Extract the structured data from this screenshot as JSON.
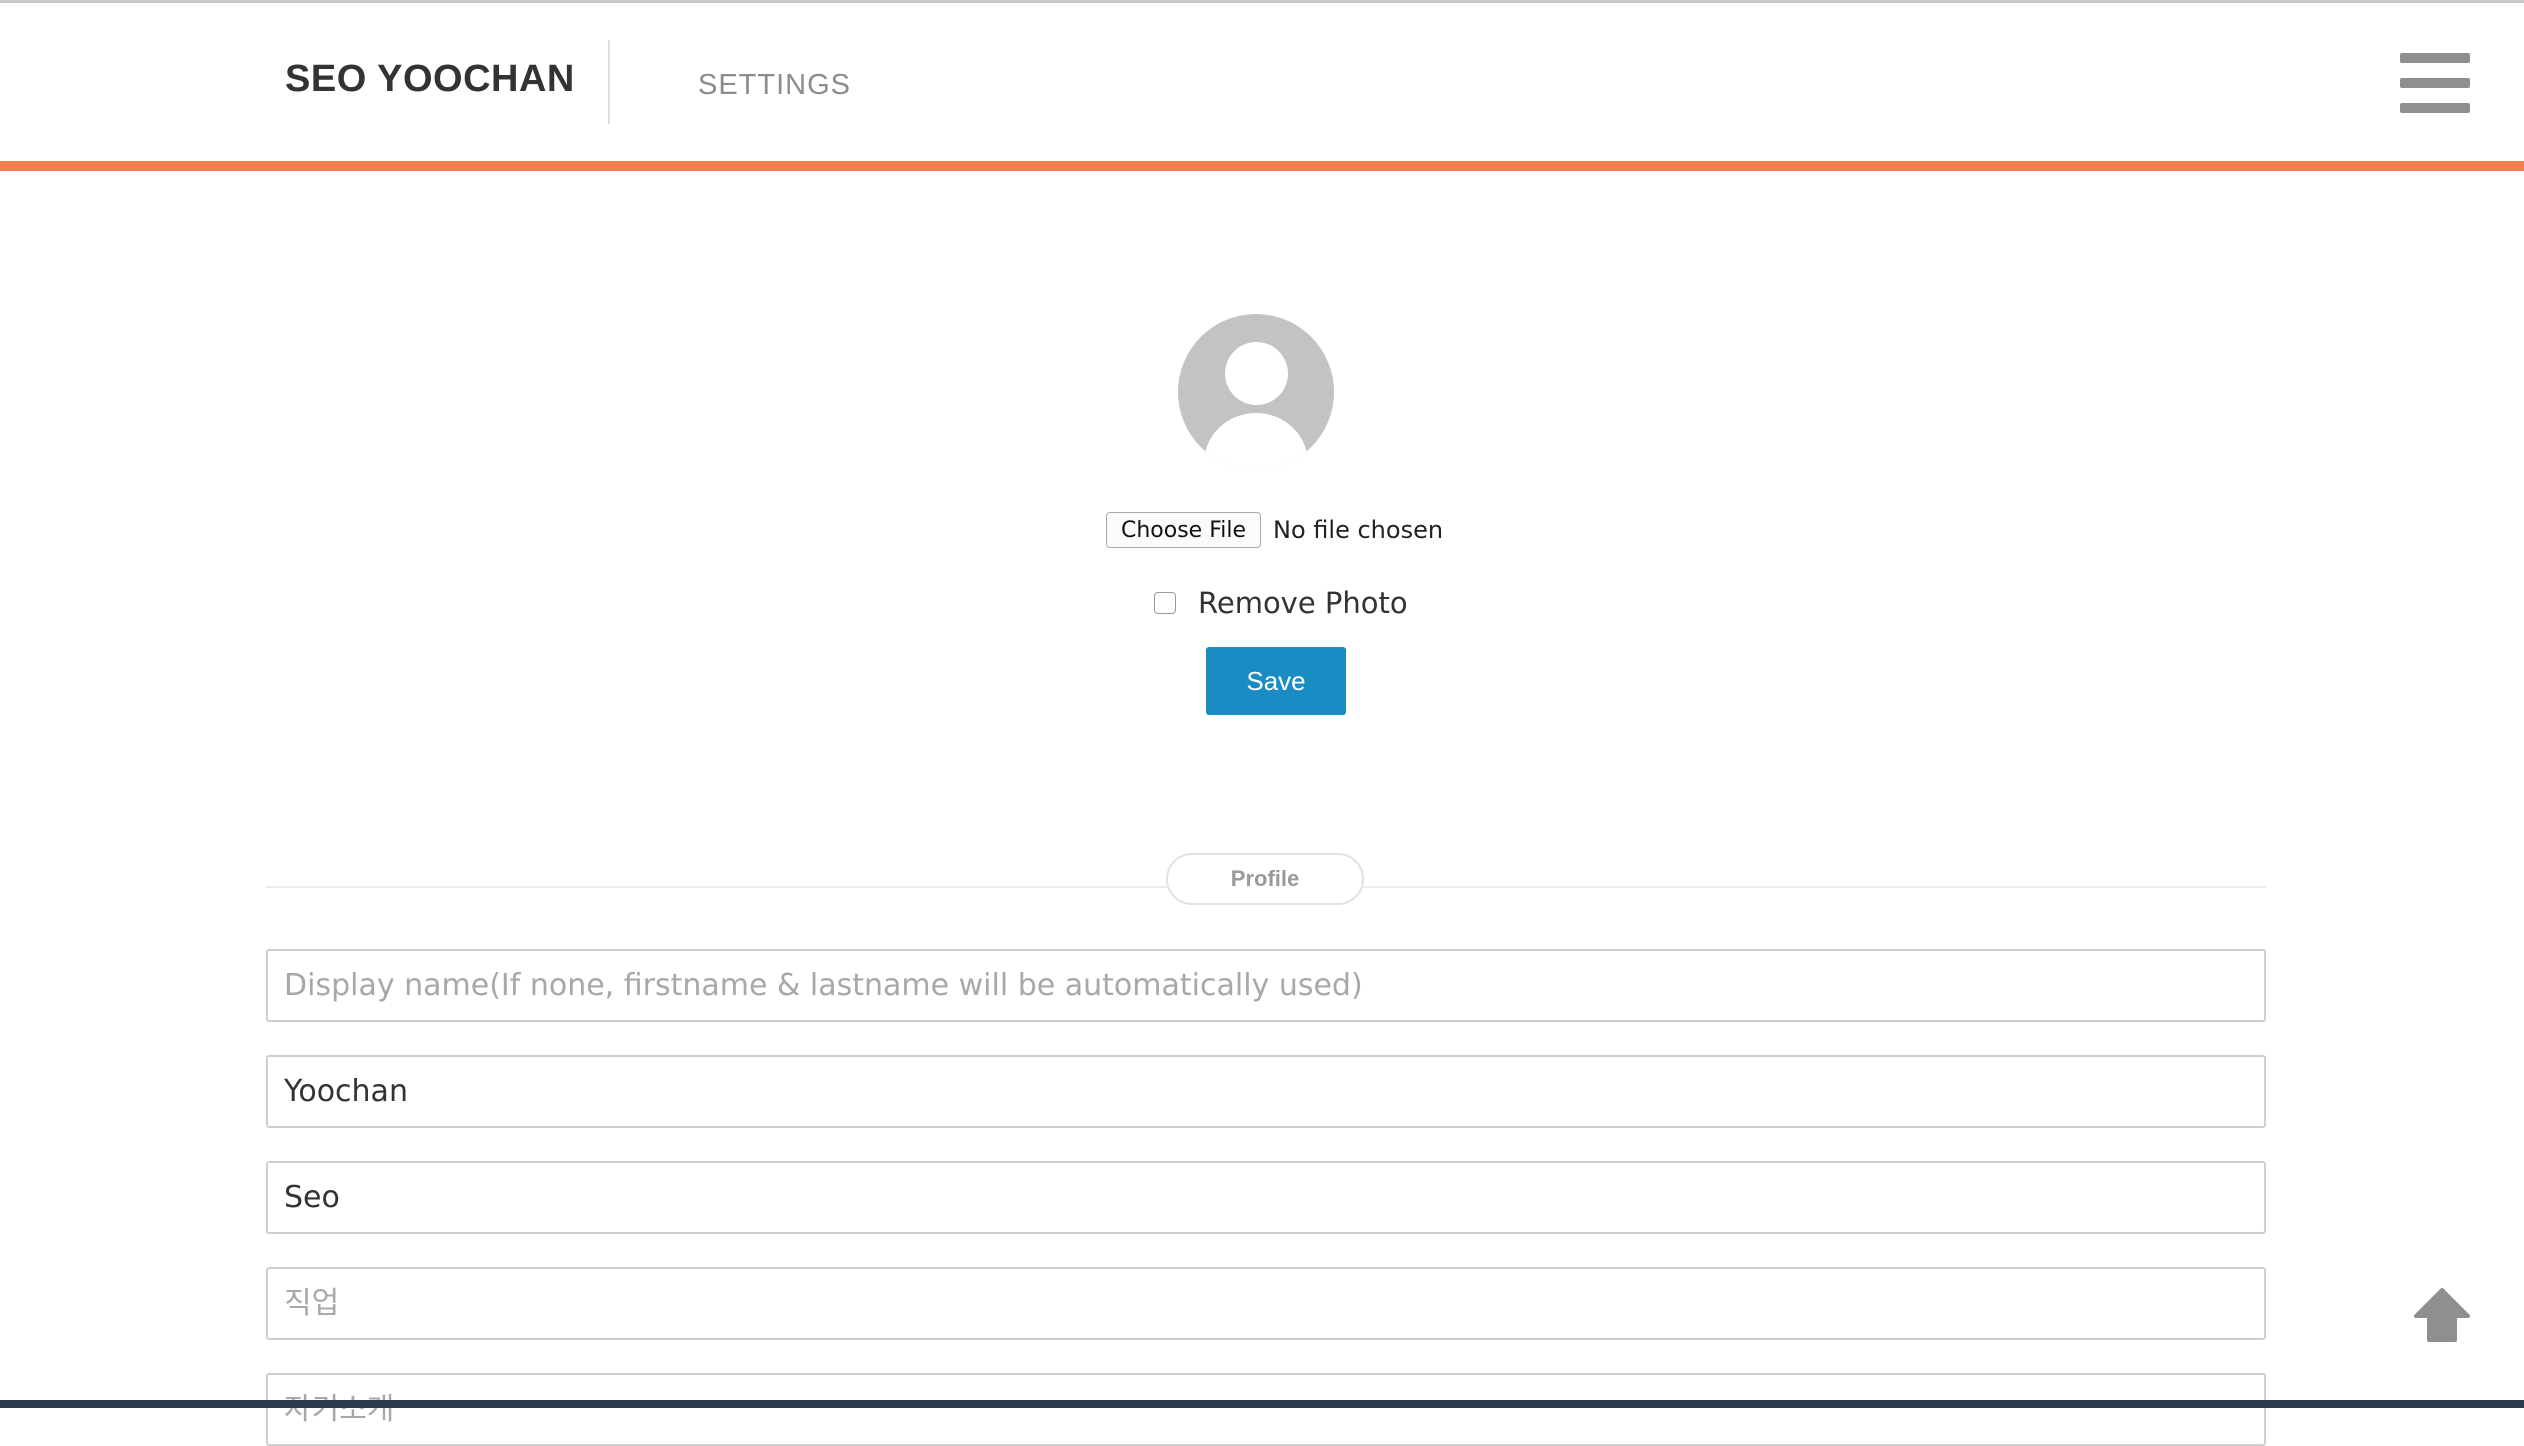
{
  "header": {
    "brand": "SEO YOOCHAN",
    "nav_settings": "SETTINGS",
    "menu_icon": "hamburger-icon"
  },
  "colors": {
    "accent": "#f2814f",
    "primary_button": "#1a8cc4",
    "avatar_placeholder": "#c3c3c3"
  },
  "photo": {
    "avatar_icon": "default-user-icon",
    "choose_file_label": "Choose File",
    "file_status": "No file chosen",
    "remove_photo_label": "Remove Photo",
    "remove_photo_checked": false,
    "save_label": "Save"
  },
  "profile": {
    "section_label": "Profile",
    "fields": [
      {
        "placeholder": "Display name(If none, firstname & lastname will be automatically used)",
        "value": ""
      },
      {
        "placeholder": "",
        "value": "Yoochan"
      },
      {
        "placeholder": "",
        "value": "Seo"
      },
      {
        "placeholder": "직업",
        "value": ""
      },
      {
        "placeholder": "자기소개",
        "value": ""
      }
    ]
  },
  "scroll_top_icon": "arrow-up-icon"
}
